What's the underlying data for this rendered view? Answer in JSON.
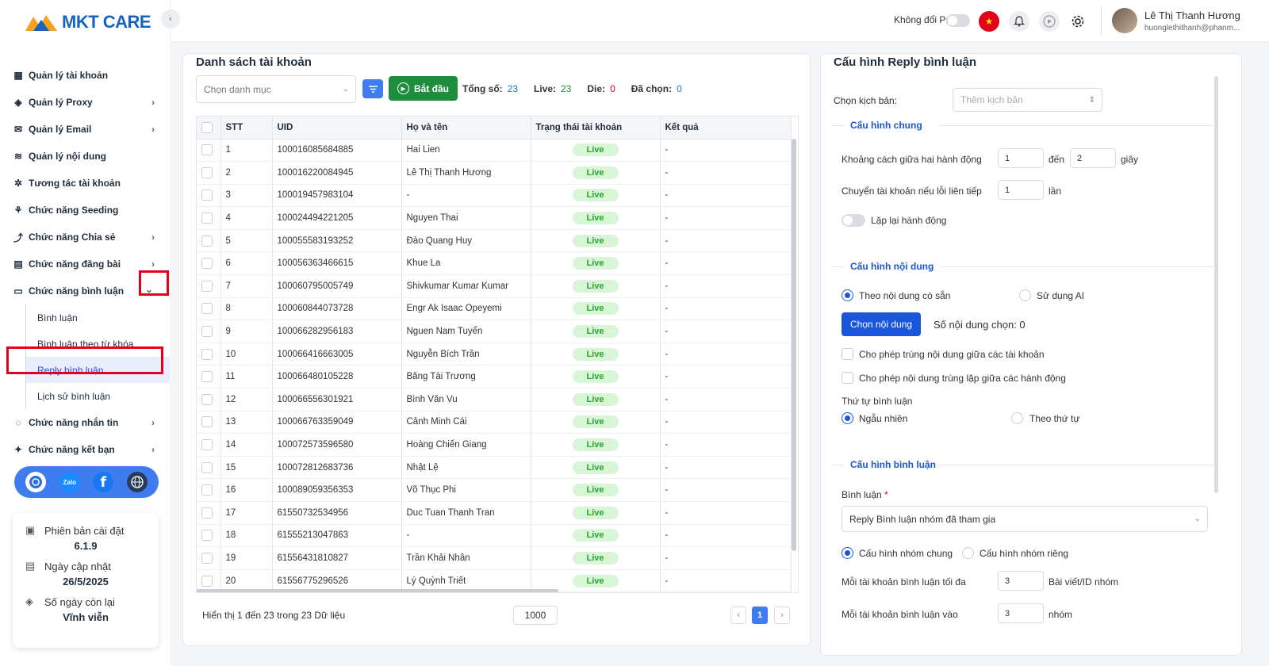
{
  "app": {
    "logo_text": "MKT CARE"
  },
  "sidebar": {
    "items": [
      {
        "label": "Quản lý tài khoản",
        "icon": "grid-icon",
        "chevron": false
      },
      {
        "label": "Quản lý Proxy",
        "icon": "layers-icon",
        "chevron": true
      },
      {
        "label": "Quản lý Email",
        "icon": "mail-icon",
        "chevron": true
      },
      {
        "label": "Quản lý nội dung",
        "icon": "content-icon",
        "chevron": false
      },
      {
        "label": "Tương tác tài khoản",
        "icon": "interaction-icon",
        "chevron": false
      },
      {
        "label": "Chức năng Seeding",
        "icon": "seeding-icon",
        "chevron": false
      },
      {
        "label": "Chức năng Chia sẻ",
        "icon": "share-icon",
        "chevron": true
      },
      {
        "label": "Chức năng đăng bài",
        "icon": "post-icon",
        "chevron": true
      },
      {
        "label": "Chức năng bình luận",
        "icon": "comment-icon",
        "chevron": true
      }
    ],
    "sub_items": [
      {
        "label": "Bình luận"
      },
      {
        "label": "Bình luận theo từ khóa"
      },
      {
        "label": "Reply bình luận"
      },
      {
        "label": "Lịch sử bình luận"
      }
    ],
    "items_after": [
      {
        "label": "Chức năng nhắn tin",
        "icon": "chat-icon",
        "chevron": true
      },
      {
        "label": "Chức năng kết bạn",
        "icon": "add-friend-icon",
        "chevron": true
      }
    ],
    "social": [
      "support-icon",
      "zalo-icon",
      "facebook-icon",
      "globe-icon"
    ],
    "social_zalo_text": "Zalo",
    "info": {
      "version_label": "Phiên bản cài đặt",
      "version_value": "6.1.9",
      "update_label": "Ngày cập nhật",
      "update_value": "26/5/2025",
      "days_label": "Số ngày còn lại",
      "days_value": "Vĩnh viễn"
    }
  },
  "topbar": {
    "proxy_label": "Không đổi Proxy",
    "user_name": "Lê Thị Thanh Hương",
    "user_email": "huonglethithanh@phanm..."
  },
  "accounts_panel": {
    "title": "Danh sách tài khoản",
    "category_placeholder": "Chọn danh mục",
    "start_label": "Bắt đầu",
    "total_label": "Tổng số:",
    "total_value": "23",
    "live_label": "Live:",
    "live_value": "23",
    "die_label": "Die:",
    "die_value": "0",
    "selected_label": "Đã chọn:",
    "selected_value": "0",
    "columns": [
      "STT",
      "UID",
      "Họ và tên",
      "Trạng thái tài khoản",
      "Kết quả"
    ],
    "rows": [
      {
        "stt": "1",
        "uid": "100016085684885",
        "name": "Hai Lien",
        "status": "Live",
        "result": "-"
      },
      {
        "stt": "2",
        "uid": "100016220084945",
        "name": "Lê Thị Thanh Hương",
        "status": "Live",
        "result": "-"
      },
      {
        "stt": "3",
        "uid": "100019457983104",
        "name": "-",
        "status": "Live",
        "result": "-"
      },
      {
        "stt": "4",
        "uid": "100024494221205",
        "name": "Nguyen Thai",
        "status": "Live",
        "result": "-"
      },
      {
        "stt": "5",
        "uid": "100055583193252",
        "name": "Đào Quang Huy",
        "status": "Live",
        "result": "-"
      },
      {
        "stt": "6",
        "uid": "100056363466615",
        "name": "Khue La",
        "status": "Live",
        "result": "-"
      },
      {
        "stt": "7",
        "uid": "100060795005749",
        "name": "Shivkumar Kumar Kumar",
        "status": "Live",
        "result": "-"
      },
      {
        "stt": "8",
        "uid": "100060844073728",
        "name": "Engr Ak Isaac Opeyemi",
        "status": "Live",
        "result": "-"
      },
      {
        "stt": "9",
        "uid": "100066282956183",
        "name": "Nguen Nam Tuyển",
        "status": "Live",
        "result": "-"
      },
      {
        "stt": "10",
        "uid": "100066416663005",
        "name": "Nguyễn Bích Trần",
        "status": "Live",
        "result": "-"
      },
      {
        "stt": "11",
        "uid": "100066480105228",
        "name": "Băng Tài Trương",
        "status": "Live",
        "result": "-"
      },
      {
        "stt": "12",
        "uid": "100066556301921",
        "name": "Bình Văn Vu",
        "status": "Live",
        "result": "-"
      },
      {
        "stt": "13",
        "uid": "100066763359049",
        "name": "Cảnh Minh Cái",
        "status": "Live",
        "result": "-"
      },
      {
        "stt": "14",
        "uid": "100072573596580",
        "name": "Hoàng Chiến Giang",
        "status": "Live",
        "result": "-"
      },
      {
        "stt": "15",
        "uid": "100072812683736",
        "name": "Nhật Lệ",
        "status": "Live",
        "result": "-"
      },
      {
        "stt": "16",
        "uid": "100089059356353",
        "name": "Võ Thục Phi",
        "status": "Live",
        "result": "-"
      },
      {
        "stt": "17",
        "uid": "61550732534956",
        "name": "Duc Tuan Thanh Tran",
        "status": "Live",
        "result": "-"
      },
      {
        "stt": "18",
        "uid": "61555213047863",
        "name": "-",
        "status": "Live",
        "result": "-"
      },
      {
        "stt": "19",
        "uid": "61556431810827",
        "name": "Trần Khải Nhân",
        "status": "Live",
        "result": "-"
      },
      {
        "stt": "20",
        "uid": "61556775296526",
        "name": "Lý Quỳnh Triết",
        "status": "Live",
        "result": "-"
      }
    ],
    "footer_text": "Hiển thị 1 đến 23 trong 23 Dữ liệu",
    "page_size": "1000",
    "current_page": "1"
  },
  "config_panel": {
    "title": "Cấu hình Reply bình luận",
    "script_label": "Chọn kịch bản:",
    "script_placeholder": "Thêm kịch bản",
    "general_title": "Cấu hình chung",
    "delay_label": "Khoảng cách giữa hai hành động",
    "delay_from": "1",
    "delay_to_label": "đến",
    "delay_to": "2",
    "delay_unit": "giây",
    "switch_label": "Chuyển tài khoản nếu lỗi liên tiếp",
    "switch_value": "1",
    "switch_unit": "lần",
    "repeat_label": "Lặp lại hành động",
    "content_title": "Cấu hình nội dung",
    "opt_available": "Theo nội dung có sẵn",
    "opt_ai": "Sử dụng AI",
    "choose_content": "Chọn nội dung",
    "content_count": "Số nội dung chọn: 0",
    "allow_dup_accounts": "Cho phép trùng nội dung giữa các tài khoản",
    "allow_dup_actions": "Cho phép nội dung trùng lặp giữa các hành động",
    "order_label": "Thứ tự bình luận",
    "order_random": "Ngẫu nhiên",
    "order_sequential": "Theo thứ tự",
    "comment_title": "Cấu hình bình luận",
    "comment_label": "Bình luận",
    "comment_required": "*",
    "comment_select": "Reply Bình luận nhóm đã tham gia",
    "group_common": "Cấu hình nhóm chung",
    "group_private": "Cấu hình nhóm riêng",
    "max_comment_label": "Mỗi tài khoản bình luận tối đa",
    "max_comment_value": "3",
    "max_comment_unit": "Bài viết/ID nhóm",
    "comment_in_label": "Mỗi tài khoản bình luận vào",
    "comment_in_value": "3",
    "comment_in_unit": "nhóm"
  }
}
